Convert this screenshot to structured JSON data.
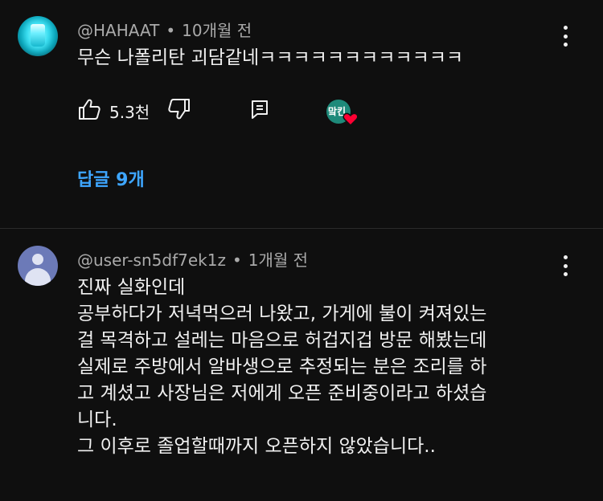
{
  "comment1": {
    "author": "@HAHAAT",
    "time": "10개월 전",
    "separator": "•",
    "text": "무슨 나폴리탄 괴담같네ㅋㅋㅋㅋㅋㅋㅋㅋㅋㅋㅋㅋ",
    "likes": "5.3천",
    "creator_badge": "맠킨",
    "replies_label": "답글 9개",
    "icons": [
      "like-icon",
      "dislike-icon",
      "reply-icon",
      "heart-icon",
      "more-options-icon"
    ]
  },
  "comment2": {
    "author": "@user-sn5df7ek1z",
    "time": "1개월 전",
    "separator": "•",
    "lines": [
      "진짜 실화인데",
      "공부하다가 저녁먹으러 나왔고, 가게에 불이 켜져있는",
      "걸 목격하고 설레는 마음으로 허겁지겁 방문 해봤는데",
      "실제로 주방에서 알바생으로 추정되는 분은 조리를 하",
      "고 계셨고 사장님은 저에게 오픈 준비중이라고 하셨습",
      "니다.",
      "그 이후로 졸업할때까지 오픈하지 않았습니다.."
    ]
  },
  "colors": {
    "background": "#0f0f0f",
    "text": "#f1f1f1",
    "meta": "#aaaaaa",
    "link": "#3ea6ff",
    "heart": "#ff0033"
  }
}
